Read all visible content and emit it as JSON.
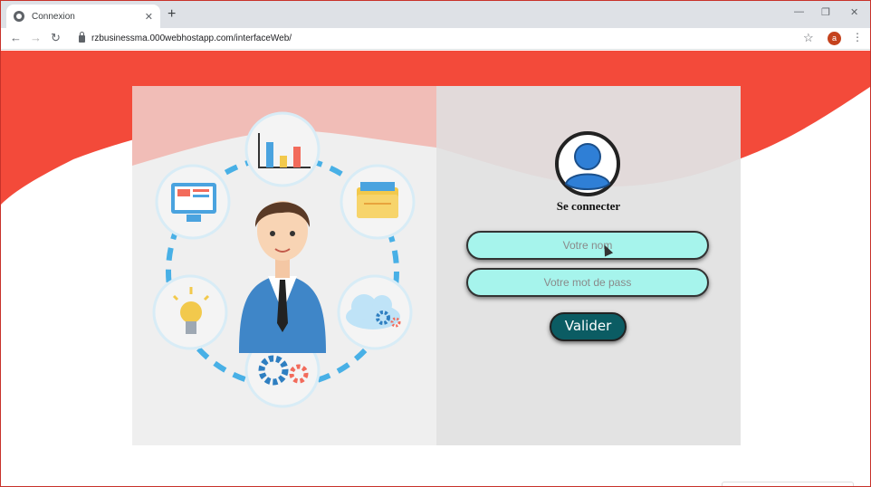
{
  "browser": {
    "tab_title": "Connexion",
    "tab_close": "✕",
    "new_tab": "+",
    "url": "rzbusinessma.000webhostapp.com/interfaceWeb/",
    "profile_initial": "a",
    "window_minimize": "—",
    "window_restore": "❐",
    "window_close": "✕",
    "back": "←",
    "forward": "→",
    "reload": "↻",
    "star": "☆",
    "menu": "⋮"
  },
  "login": {
    "title": "Se connecter",
    "username_placeholder": "Votre nom",
    "password_placeholder": "Votre mot de pass",
    "submit_label": "Valider"
  },
  "colors": {
    "header_red": "#f34a3a",
    "field_bg": "#a6f4ec",
    "button_bg": "#0b5c63"
  }
}
